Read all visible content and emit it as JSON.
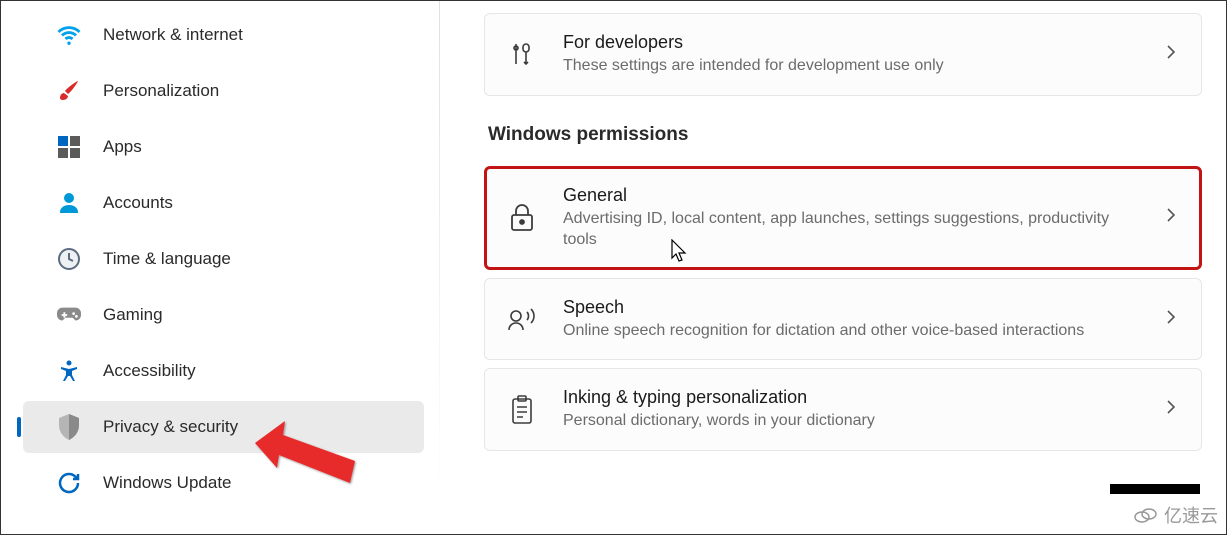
{
  "sidebar": {
    "items": [
      {
        "label": "Network & internet",
        "icon": "wifi-icon",
        "active": false
      },
      {
        "label": "Personalization",
        "icon": "paintbrush-icon",
        "active": false
      },
      {
        "label": "Apps",
        "icon": "apps-icon",
        "active": false
      },
      {
        "label": "Accounts",
        "icon": "account-icon",
        "active": false
      },
      {
        "label": "Time & language",
        "icon": "clock-icon",
        "active": false
      },
      {
        "label": "Gaming",
        "icon": "gamepad-icon",
        "active": false
      },
      {
        "label": "Accessibility",
        "icon": "accessibility-icon",
        "active": false
      },
      {
        "label": "Privacy & security",
        "icon": "shield-icon",
        "active": true
      },
      {
        "label": "Windows Update",
        "icon": "update-icon",
        "active": false
      }
    ]
  },
  "main": {
    "cards_top": [
      {
        "title": "For developers",
        "desc": "These settings are intended for development use only",
        "icon": "tools-icon"
      }
    ],
    "section_header": "Windows permissions",
    "cards": [
      {
        "title": "General",
        "desc": "Advertising ID, local content, app launches, settings suggestions, productivity tools",
        "icon": "lock-icon",
        "highlighted": true
      },
      {
        "title": "Speech",
        "desc": "Online speech recognition for dictation and other voice-based interactions",
        "icon": "speech-icon",
        "highlighted": false
      },
      {
        "title": "Inking & typing personalization",
        "desc": "Personal dictionary, words in your dictionary",
        "icon": "clipboard-icon",
        "highlighted": false
      }
    ]
  },
  "watermark": "亿速云"
}
